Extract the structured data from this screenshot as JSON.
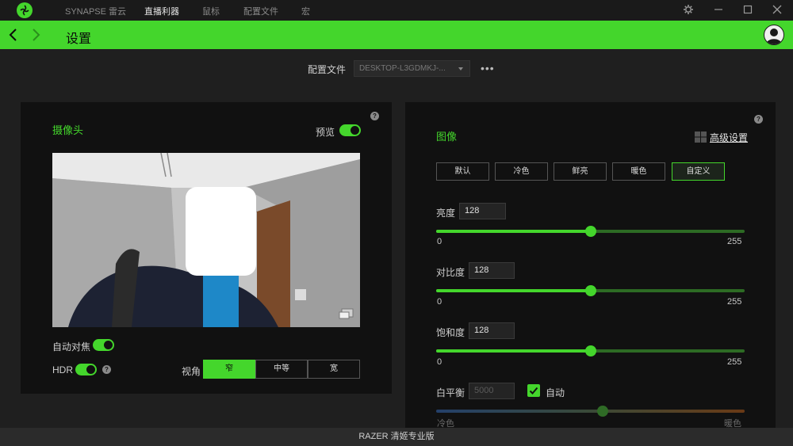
{
  "titlebar": {
    "tabs": [
      {
        "label": "SYNAPSE 雷云"
      },
      {
        "label": "直播利器"
      },
      {
        "label": "鼠标"
      },
      {
        "label": "配置文件"
      },
      {
        "label": "宏"
      }
    ]
  },
  "header": {
    "title": "设置"
  },
  "profile": {
    "label": "配置文件",
    "selected": "DESKTOP-L3GDMKJ-...",
    "more": "•••"
  },
  "camera": {
    "title": "摄像头",
    "preview_label": "预览",
    "autofocus_label": "自动对焦",
    "hdr_label": "HDR",
    "view_angle_label": "视角",
    "view_angles": [
      {
        "label": "窄"
      },
      {
        "label": "中等"
      },
      {
        "label": "宽"
      }
    ],
    "view_angle_selected": "窄"
  },
  "image": {
    "title": "图像",
    "advanced_label": "高级设置",
    "presets": [
      {
        "label": "默认"
      },
      {
        "label": "冷色"
      },
      {
        "label": "鲜亮"
      },
      {
        "label": "暖色"
      },
      {
        "label": "自定义"
      }
    ],
    "preset_selected": "自定义",
    "brightness": {
      "label": "亮度",
      "value": "128",
      "min": "0",
      "max": "255",
      "level": 128
    },
    "contrast": {
      "label": "对比度",
      "value": "128",
      "min": "0",
      "max": "255",
      "level": 128
    },
    "saturation": {
      "label": "饱和度",
      "value": "128",
      "min": "0",
      "max": "255",
      "level": 128
    },
    "white_balance": {
      "label": "白平衡",
      "value": "5000",
      "auto_label": "自动",
      "auto_checked": true,
      "left_label": "冷色",
      "right_label": "暖色",
      "level_fraction": 0.54
    }
  },
  "help_glyph": "?",
  "statusbar": {
    "text": "RAZER 清姬专业版"
  },
  "colors": {
    "accent": "#44d62c",
    "panel": "#111111",
    "background": "#1f1f1f"
  }
}
